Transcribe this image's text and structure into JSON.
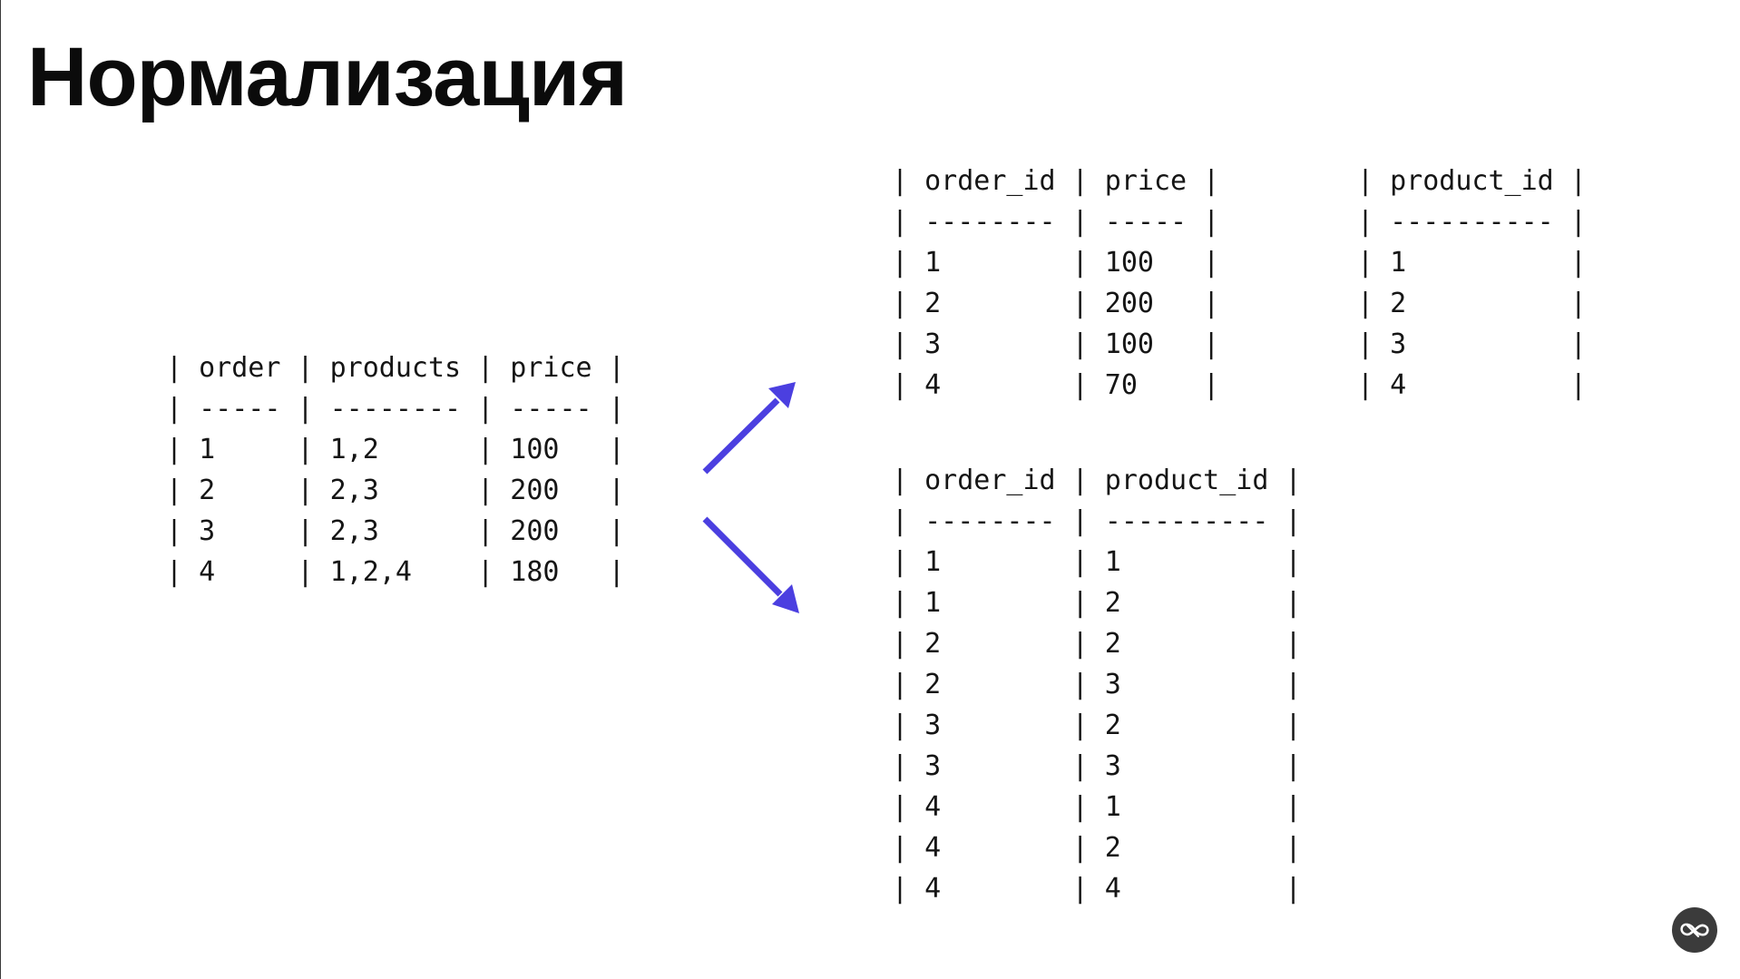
{
  "slide": {
    "title": "Нормализация"
  },
  "tables": {
    "orders": {
      "lines": [
        "| order | products | price |",
        "| ----- | -------- | ----- |",
        "| 1     | 1,2      | 100   |",
        "| 2     | 2,3      | 200   |",
        "| 3     | 2,3      | 200   |",
        "| 4     | 1,2,4    | 180   |"
      ]
    },
    "order_price": {
      "lines": [
        "| order_id | price |",
        "| -------- | ----- |",
        "| 1        | 100   |",
        "| 2        | 200   |",
        "| 3        | 100   |",
        "| 4        | 70    |"
      ]
    },
    "products": {
      "lines": [
        "| product_id |",
        "| ---------- |",
        "| 1          |",
        "| 2          |",
        "| 3          |",
        "| 4          |"
      ]
    },
    "order_products": {
      "lines": [
        "| order_id | product_id |",
        "| -------- | ---------- |",
        "| 1        | 1          |",
        "| 1        | 2          |",
        "| 2        | 2          |",
        "| 2        | 3          |",
        "| 3        | 2          |",
        "| 3        | 3          |",
        "| 4        | 1          |",
        "| 4        | 2          |",
        "| 4        | 4          |"
      ]
    }
  },
  "colors": {
    "arrow": "#4b3fe0",
    "text": "#151515",
    "background": "#ffffff"
  },
  "icons": {
    "arrow_up": "arrow-up-right-icon",
    "arrow_down": "arrow-down-right-icon",
    "logo": "logo-badge-icon"
  }
}
